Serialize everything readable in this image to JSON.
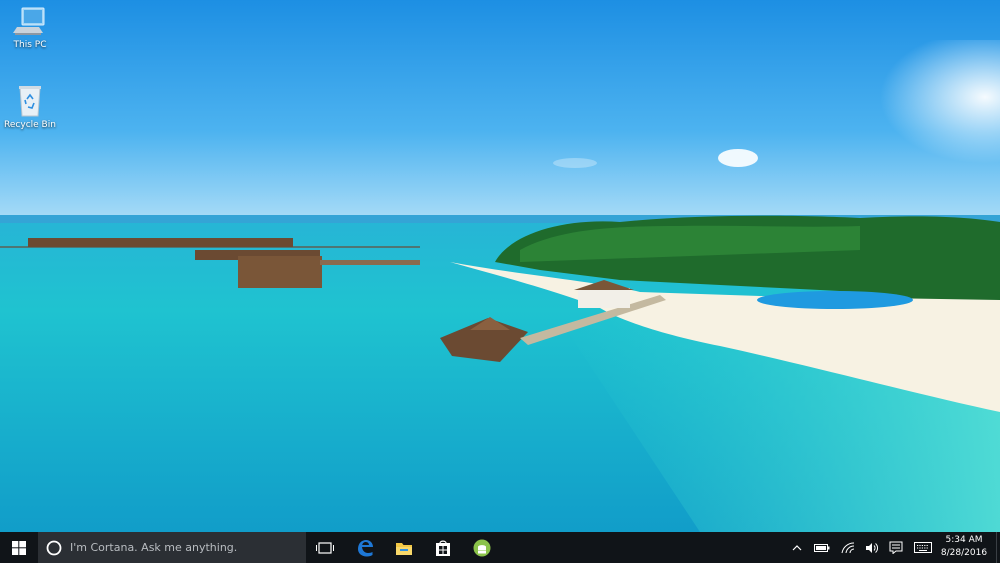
{
  "desktop": {
    "icons": [
      {
        "label": "This PC",
        "icon": "this-pc-icon"
      },
      {
        "label": "Recycle Bin",
        "icon": "recycle-bin-icon"
      }
    ],
    "wallpaper": "tropical-island-resort"
  },
  "taskbar": {
    "search_placeholder": "I'm Cortana. Ask me anything.",
    "apps": [
      {
        "name": "task-view",
        "icon": "task-view-icon"
      },
      {
        "name": "edge",
        "icon": "edge-icon",
        "color": "#1e78d6"
      },
      {
        "name": "file-explorer",
        "icon": "folder-icon",
        "color": "#f2c744"
      },
      {
        "name": "store",
        "icon": "store-icon"
      },
      {
        "name": "android",
        "icon": "android-icon",
        "color": "#8bc34a"
      }
    ],
    "tray": [
      "chevron-up-icon",
      "battery-icon",
      "wifi-icon",
      "volume-icon",
      "notification-icon",
      "keyboard-icon"
    ],
    "clock": {
      "time": "5:34 AM",
      "date": "8/28/2016"
    }
  }
}
